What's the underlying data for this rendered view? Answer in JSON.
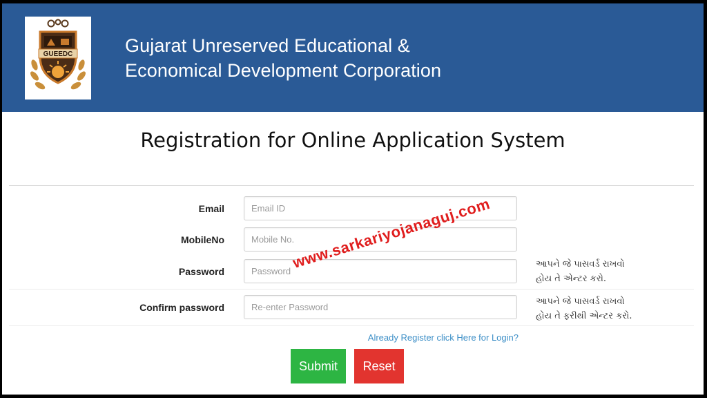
{
  "header": {
    "logo_text": "GUEEDC",
    "org_line1": "Gujarat Unreserved Educational &",
    "org_line2": "Economical Development Corporation"
  },
  "page_title": "Registration for Online Application System",
  "form": {
    "email": {
      "label": "Email",
      "placeholder": "Email ID",
      "value": ""
    },
    "mobile": {
      "label": "MobileNo",
      "placeholder": "Mobile No.",
      "value": ""
    },
    "password": {
      "label": "Password",
      "placeholder": "Password",
      "value": "",
      "hint_line1": "આપને જે પાસવર્ડ રાખવો",
      "hint_line2": "હોય તે એન્ટર કરો."
    },
    "confirm": {
      "label": "Confirm password",
      "placeholder": "Re-enter Password",
      "value": "",
      "hint_line1": "આપને જે પાસવર્ડ રાખવો",
      "hint_line2": "હોય તે ફરીથી એન્ટર કરો."
    },
    "login_link": "Already Register click Here for Login?",
    "submit_label": "Submit",
    "reset_label": "Reset"
  },
  "watermark": "www.sarkariyojanaguj.com",
  "colors": {
    "header_bg": "#2a5a96",
    "submit_bg": "#2db543",
    "reset_bg": "#e2342f",
    "link": "#3d8fc7",
    "watermark": "#e01d1d"
  }
}
